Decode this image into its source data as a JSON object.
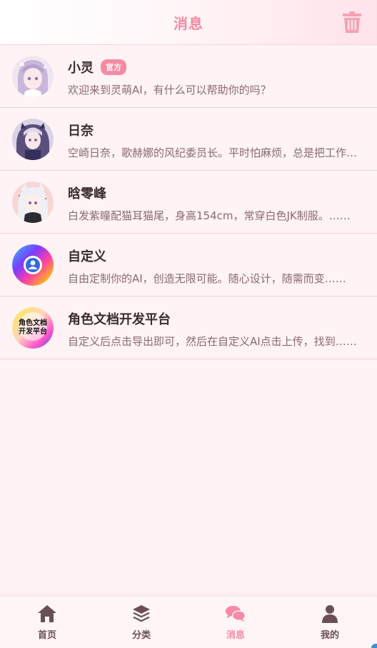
{
  "header": {
    "title": "消息"
  },
  "chats": [
    {
      "name": "小灵",
      "badge": "官方",
      "desc": "欢迎来到灵萌AI，有什么可以帮助你的吗？",
      "avatar": "girl-lilac"
    },
    {
      "name": "日奈",
      "badge": "",
      "desc": "空崎日奈，歌赫娜的风纪委员长。平时怕麻烦，总是把工作放在第一位……",
      "avatar": "girl-dark"
    },
    {
      "name": "晗零峰",
      "badge": "",
      "desc": "白发紫瞳配猫耳猫尾，身高154cm，常穿白色JK制服。……",
      "avatar": "girl-white"
    },
    {
      "name": "自定义",
      "badge": "",
      "desc": "自由定制你的AI，创造无限可能。随心设计，随需而变……",
      "avatar": "gradient-user"
    },
    {
      "name": "角色文档开发平台",
      "badge": "",
      "desc": "自定义后点击导出即可，然后在自定义AI点击上传，找到……",
      "avatar": "doc-platform",
      "avatar_text_line1": "角色文档",
      "avatar_text_line2": "开发平台"
    }
  ],
  "tabs": [
    {
      "label": "首页",
      "icon": "home-icon",
      "active": false
    },
    {
      "label": "分类",
      "icon": "layers-icon",
      "active": false
    },
    {
      "label": "消息",
      "icon": "chat-icon",
      "active": true
    },
    {
      "label": "我的",
      "icon": "user-icon",
      "active": false
    }
  ],
  "colors": {
    "accent": "#f58ba4",
    "background": "#fff3f5",
    "divider": "#f3cfd6"
  }
}
